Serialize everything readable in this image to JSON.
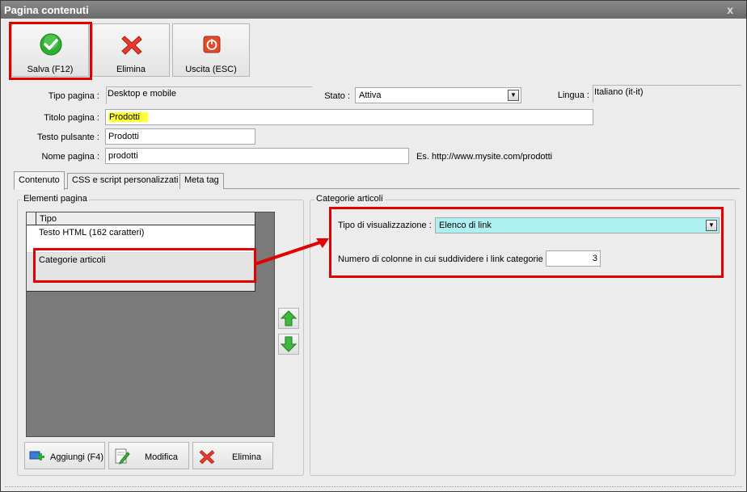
{
  "window": {
    "title": "Pagina contenuti",
    "close_label": "x"
  },
  "toolbar": {
    "save_label": "Salva (F12)",
    "delete_label": "Elimina",
    "exit_label": "Uscita (ESC)"
  },
  "form": {
    "tipo_pagina_label": "Tipo pagina :",
    "tipo_pagina_value": "Desktop e mobile",
    "stato_label": "Stato :",
    "stato_value": "Attiva",
    "lingua_label": "Lingua :",
    "lingua_value": "Italiano (it-it)",
    "titolo_label": "Titolo pagina :",
    "titolo_value": "Prodotti",
    "testo_pulsante_label": "Testo pulsante :",
    "testo_pulsante_value": "Prodotti",
    "nome_pagina_label": "Nome pagina :",
    "nome_pagina_value": "prodotti",
    "url_example": "Es. http://www.mysite.com/prodotti"
  },
  "tabs": [
    {
      "label": "Contenuto"
    },
    {
      "label": "CSS e script personalizzati"
    },
    {
      "label": "Meta tag"
    }
  ],
  "elements_panel": {
    "title": "Elementi pagina",
    "column_header": "Tipo",
    "rows": [
      {
        "label": "Testo HTML (162 caratteri)"
      },
      {
        "label": "Categorie articoli"
      }
    ],
    "add_label": "Aggiungi (F4)",
    "edit_label": "Modifica",
    "delete_label": "Elimina"
  },
  "categories_panel": {
    "title": "Categorie articoli",
    "view_type_label": "Tipo di visualizzazione :",
    "view_type_value": "Elenco di link",
    "columns_label": "Numero di colonne in cui suddividere i link categorie :",
    "columns_value": "3"
  },
  "colors": {
    "highlight_red": "#e20000",
    "title_highlight": "#ffff33",
    "select_cyan": "#aef0f2",
    "arrow_green": "#3fb83f"
  }
}
